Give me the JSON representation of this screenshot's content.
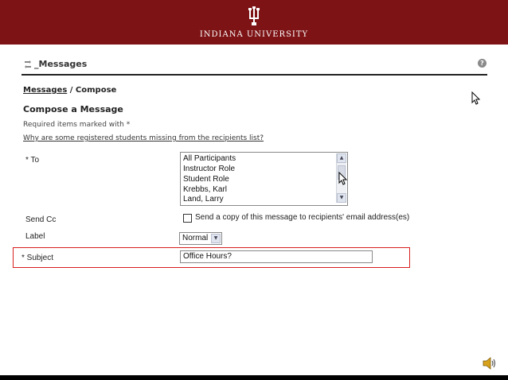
{
  "header": {
    "university_name": "INDIANA UNIVERSITY",
    "logo_icon": "trident-icon",
    "color": "#7d1315"
  },
  "tool": {
    "title": "_Messages",
    "icon": "messages-icon",
    "help_label": "?"
  },
  "breadcrumb": {
    "parent": "Messages",
    "separator": " / ",
    "current": "Compose"
  },
  "compose": {
    "title": "Compose a Message",
    "required_note": "Required items marked with *",
    "why_link": "Why are some registered students missing from the recipients list?"
  },
  "to_field": {
    "label": "* To",
    "options": [
      "All Participants",
      "Instructor Role",
      "Student Role",
      "Krebbs, Karl",
      "Land, Larry"
    ]
  },
  "cc_field": {
    "label": "Send Cc",
    "checkbox_text": "Send a copy of this message to recipients' email address(es)"
  },
  "label_field": {
    "label": "Label",
    "selected": "Normal"
  },
  "subject_field": {
    "label": "* Subject",
    "value": "Office Hours?",
    "highlight_color": "#d81e1e"
  }
}
